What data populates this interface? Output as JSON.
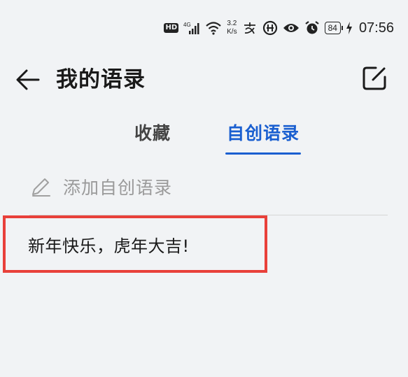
{
  "status_bar": {
    "hd_label": "HD",
    "signal_label": "4G",
    "net_speed_value": "3.2",
    "net_speed_unit": "K/s",
    "battery_level": "84",
    "time": "07:56"
  },
  "header": {
    "title": "我的语录",
    "back_icon": "arrow-left-icon",
    "edit_icon": "edit-square-icon"
  },
  "tabs": [
    {
      "label": "收藏",
      "active": false
    },
    {
      "label": "自创语录",
      "active": true
    }
  ],
  "add_row": {
    "icon": "pencil-icon",
    "label": "添加自创语录"
  },
  "quotes": [
    {
      "text": "新年快乐，虎年大吉!"
    }
  ],
  "colors": {
    "accent": "#1a5fd0",
    "highlight_border": "#e8403a",
    "background": "#f1f3f5"
  }
}
